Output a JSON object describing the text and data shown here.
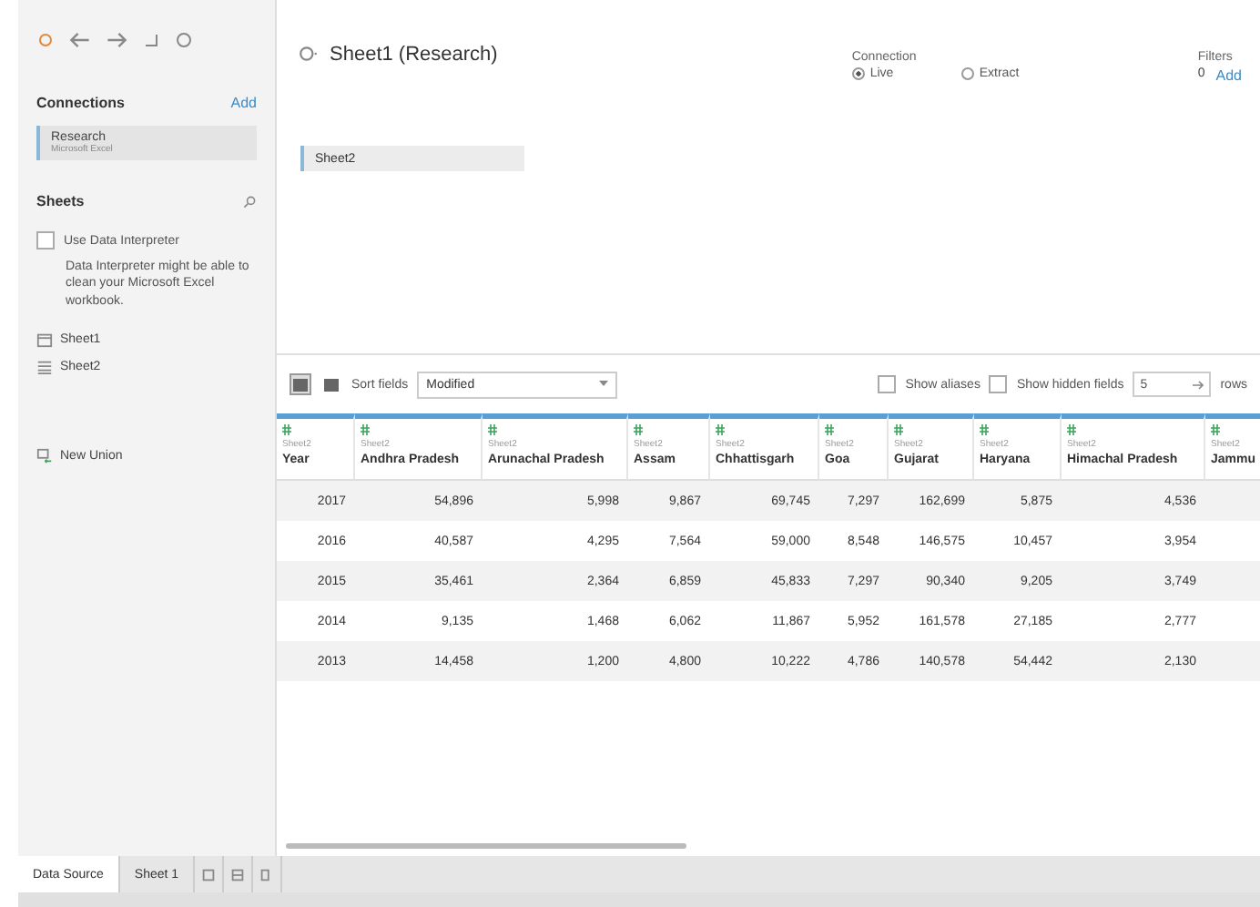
{
  "sidebar": {
    "connections": {
      "title": "Connections",
      "add": "Add",
      "items": [
        {
          "name": "Research",
          "type": "Microsoft Excel",
          "selected": true
        }
      ]
    },
    "sheets": {
      "title": "Sheets",
      "interpreter": {
        "label": "Use Data Interpreter",
        "checked": false,
        "note": "Data Interpreter might be able to clean your Microsoft Excel workbook."
      },
      "items": [
        {
          "kind": "sheet",
          "label": "Sheet1"
        },
        {
          "kind": "table",
          "label": "Sheet2"
        }
      ],
      "new_union": "New Union"
    }
  },
  "header": {
    "title": "Sheet1 (Research)",
    "connection": {
      "label": "Connection",
      "options": [
        {
          "label": "Live",
          "selected": true
        },
        {
          "label": "Extract",
          "selected": false
        }
      ]
    },
    "filters": {
      "label": "Filters",
      "count": "0",
      "add": "Add"
    }
  },
  "canvas": {
    "tables": [
      "Sheet2"
    ]
  },
  "grid_toolbar": {
    "sort_label": "Sort fields",
    "sort_value": "Modified",
    "show_aliases": {
      "label": "Show aliases",
      "checked": false
    },
    "show_hidden": {
      "label": "Show hidden fields",
      "checked": false
    },
    "rows_value": "5",
    "rows_label": "rows"
  },
  "table": {
    "columns": [
      {
        "source": "Sheet2",
        "name": "Year"
      },
      {
        "source": "Sheet2",
        "name": "Andhra Pradesh"
      },
      {
        "source": "Sheet2",
        "name": "Arunachal Pradesh"
      },
      {
        "source": "Sheet2",
        "name": "Assam"
      },
      {
        "source": "Sheet2",
        "name": "Chhattisgarh"
      },
      {
        "source": "Sheet2",
        "name": "Goa"
      },
      {
        "source": "Sheet2",
        "name": "Gujarat"
      },
      {
        "source": "Sheet2",
        "name": "Haryana"
      },
      {
        "source": "Sheet2",
        "name": "Himachal Pradesh"
      },
      {
        "source": "Sheet2",
        "name": "Jammu"
      }
    ],
    "rows": [
      [
        "2017",
        "54,896",
        "5,998",
        "9,867",
        "69,745",
        "7,297",
        "162,699",
        "5,875",
        "4,536",
        ""
      ],
      [
        "2016",
        "40,587",
        "4,295",
        "7,564",
        "59,000",
        "8,548",
        "146,575",
        "10,457",
        "3,954",
        ""
      ],
      [
        "2015",
        "35,461",
        "2,364",
        "6,859",
        "45,833",
        "7,297",
        "90,340",
        "9,205",
        "3,749",
        ""
      ],
      [
        "2014",
        "9,135",
        "1,468",
        "6,062",
        "11,867",
        "5,952",
        "161,578",
        "27,185",
        "2,777",
        ""
      ],
      [
        "2013",
        "14,458",
        "1,200",
        "4,800",
        "10,222",
        "4,786",
        "140,578",
        "54,442",
        "2,130",
        ""
      ]
    ]
  },
  "bottom_tabs": [
    {
      "label": "Data Source",
      "selected": true
    },
    {
      "label": "Sheet 1",
      "selected": false
    }
  ]
}
